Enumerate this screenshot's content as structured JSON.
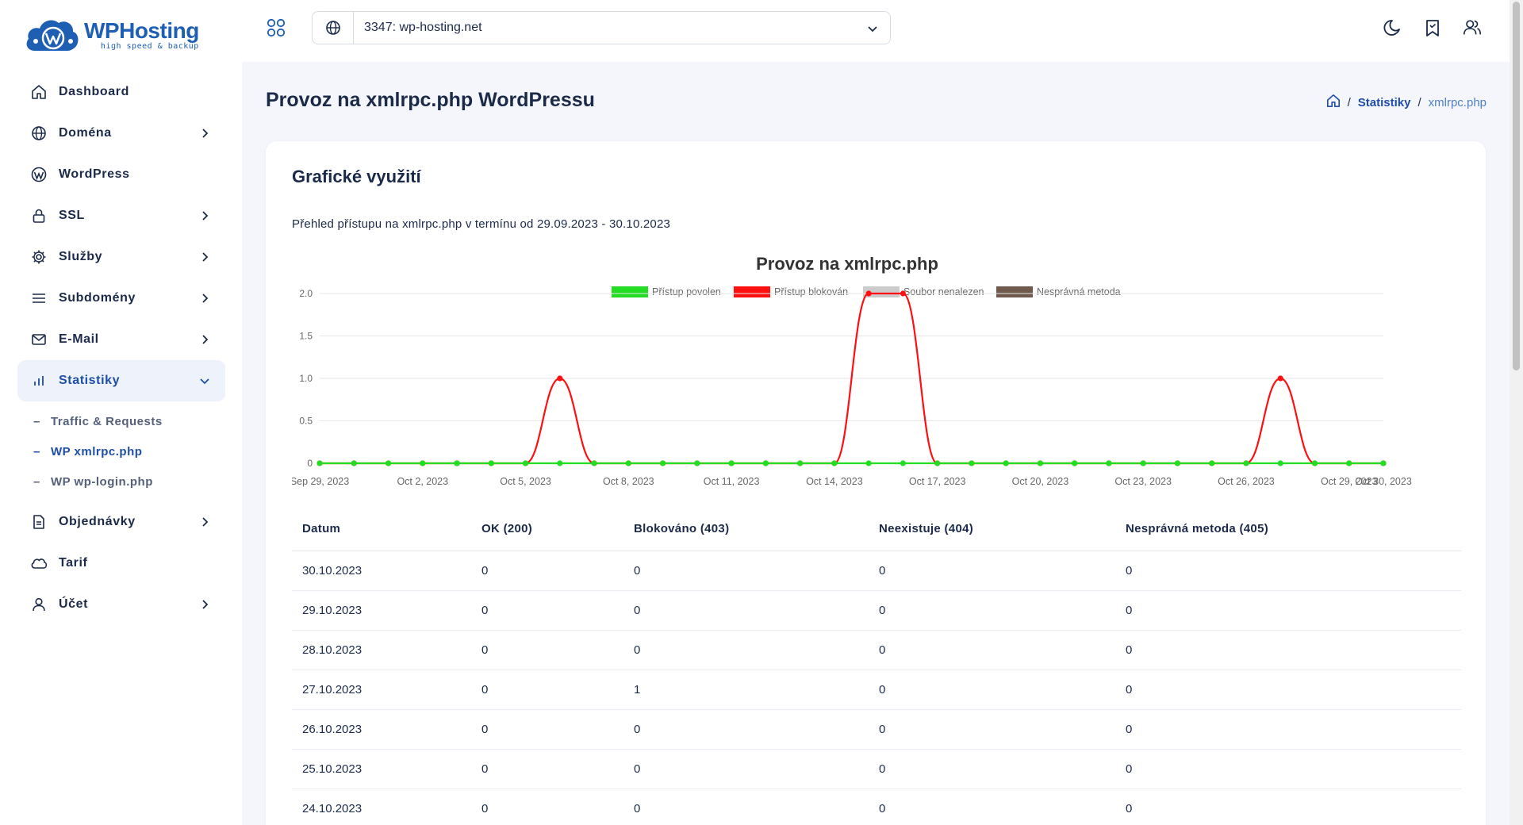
{
  "brand": {
    "name": "WPHosting",
    "tagline": "high speed & backup",
    "color": "#1e5fb3"
  },
  "sidebar": {
    "items": [
      {
        "label": "Dashboard",
        "icon": "home-icon",
        "has_chevron": false
      },
      {
        "label": "Doména",
        "icon": "globe-icon",
        "has_chevron": true
      },
      {
        "label": "WordPress",
        "icon": "wordpress-icon",
        "has_chevron": false
      },
      {
        "label": "SSL",
        "icon": "lock-icon",
        "has_chevron": true
      },
      {
        "label": "Služby",
        "icon": "gear-icon",
        "has_chevron": true
      },
      {
        "label": "Subdomény",
        "icon": "menu-icon",
        "has_chevron": true
      },
      {
        "label": "E-Mail",
        "icon": "mail-icon",
        "has_chevron": true
      },
      {
        "label": "Statistiky",
        "icon": "bar-chart-icon",
        "has_chevron": true,
        "active": true,
        "children": [
          {
            "label": "Traffic & Requests"
          },
          {
            "label": "WP xmlrpc.php",
            "active": true
          },
          {
            "label": "WP wp-login.php"
          }
        ]
      },
      {
        "label": "Objednávky",
        "icon": "document-icon",
        "has_chevron": true
      },
      {
        "label": "Tarif",
        "icon": "cloud-icon",
        "has_chevron": false
      },
      {
        "label": "Účet",
        "icon": "user-icon",
        "has_chevron": true
      }
    ]
  },
  "topbar": {
    "domain_value": "3347: wp-hosting.net",
    "icons": [
      "moon-icon",
      "bookmark-icon",
      "users-icon"
    ]
  },
  "page": {
    "title": "Provoz na xmlrpc.php WordPressu",
    "breadcrumb": {
      "section": "Statistiky",
      "current": "xmlrpc.php"
    }
  },
  "card": {
    "title": "Grafické využití",
    "description": "Přehled přístupu na xmlrpc.php v termínu od 29.09.2023 - 30.10.2023"
  },
  "chart_data": {
    "type": "line",
    "title": "Provoz na xmlrpc.php",
    "ylim": [
      0,
      2
    ],
    "yticks": [
      "2.0",
      "1.5",
      "1.0",
      "0.5",
      "0"
    ],
    "x_tick_labels": [
      "Sep 29, 2023",
      "Oct 2, 2023",
      "Oct 5, 2023",
      "Oct 8, 2023",
      "Oct 11, 2023",
      "Oct 14, 2023",
      "Oct 17, 2023",
      "Oct 20, 2023",
      "Oct 23, 2023",
      "Oct 26, 2023",
      "Oct 29, 2023",
      "Oct 30, 2023"
    ],
    "x": [
      "2023-09-29",
      "2023-09-30",
      "2023-10-01",
      "2023-10-02",
      "2023-10-03",
      "2023-10-04",
      "2023-10-05",
      "2023-10-06",
      "2023-10-07",
      "2023-10-08",
      "2023-10-09",
      "2023-10-10",
      "2023-10-11",
      "2023-10-12",
      "2023-10-13",
      "2023-10-14",
      "2023-10-15",
      "2023-10-16",
      "2023-10-17",
      "2023-10-18",
      "2023-10-19",
      "2023-10-20",
      "2023-10-21",
      "2023-10-22",
      "2023-10-23",
      "2023-10-24",
      "2023-10-25",
      "2023-10-26",
      "2023-10-27",
      "2023-10-28",
      "2023-10-29",
      "2023-10-30"
    ],
    "series": [
      {
        "name": "Přístup povolen",
        "color": "#22dd22",
        "values": [
          0,
          0,
          0,
          0,
          0,
          0,
          0,
          0,
          0,
          0,
          0,
          0,
          0,
          0,
          0,
          0,
          0,
          0,
          0,
          0,
          0,
          0,
          0,
          0,
          0,
          0,
          0,
          0,
          0,
          0,
          0,
          0
        ]
      },
      {
        "name": "Přístup blokován",
        "color": "#ff1010",
        "values": [
          0,
          0,
          0,
          0,
          0,
          0,
          0,
          1,
          0,
          0,
          0,
          0,
          0,
          0,
          0,
          0,
          2,
          2,
          0,
          0,
          0,
          0,
          0,
          0,
          0,
          0,
          0,
          0,
          1,
          0,
          0,
          0
        ]
      },
      {
        "name": "Soubor nenalezen",
        "color": "#cccccc",
        "values": []
      },
      {
        "name": "Nesprávná metoda",
        "color": "#6f5a4d",
        "values": []
      }
    ],
    "grid": true,
    "legend": "top"
  },
  "table": {
    "columns": [
      "Datum",
      "OK (200)",
      "Blokováno (403)",
      "Neexistuje (404)",
      "Nesprávná metoda (405)"
    ],
    "rows": [
      [
        "30.10.2023",
        "0",
        "0",
        "0",
        "0"
      ],
      [
        "29.10.2023",
        "0",
        "0",
        "0",
        "0"
      ],
      [
        "28.10.2023",
        "0",
        "0",
        "0",
        "0"
      ],
      [
        "27.10.2023",
        "0",
        "1",
        "0",
        "0"
      ],
      [
        "26.10.2023",
        "0",
        "0",
        "0",
        "0"
      ],
      [
        "25.10.2023",
        "0",
        "0",
        "0",
        "0"
      ],
      [
        "24.10.2023",
        "0",
        "0",
        "0",
        "0"
      ]
    ]
  }
}
